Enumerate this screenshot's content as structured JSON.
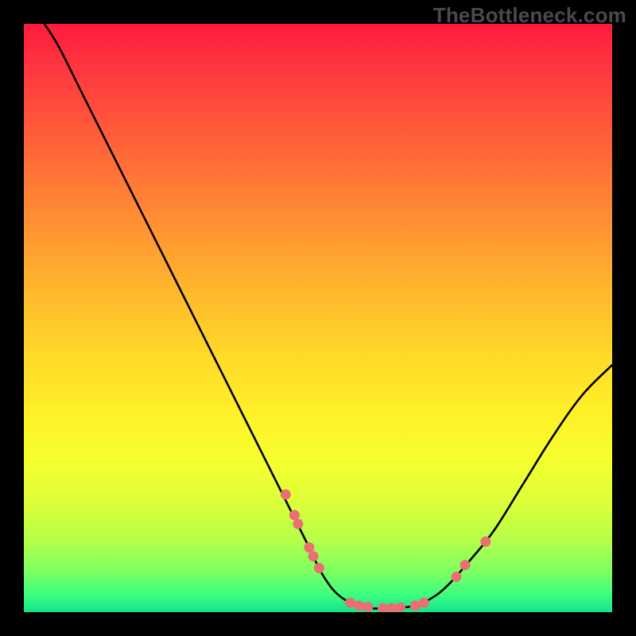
{
  "watermark": "TheBottleneck.com",
  "chart_data": {
    "type": "line",
    "title": "",
    "xlabel": "",
    "ylabel": "",
    "xlim": [
      0,
      100
    ],
    "ylim": [
      0,
      100
    ],
    "grid": false,
    "legend": false,
    "curve": [
      {
        "x": 3.5,
        "y": 100
      },
      {
        "x": 6,
        "y": 96
      },
      {
        "x": 10,
        "y": 88
      },
      {
        "x": 15,
        "y": 78
      },
      {
        "x": 20,
        "y": 68
      },
      {
        "x": 25,
        "y": 58
      },
      {
        "x": 30,
        "y": 48
      },
      {
        "x": 35,
        "y": 38
      },
      {
        "x": 40,
        "y": 28
      },
      {
        "x": 45,
        "y": 18
      },
      {
        "x": 48,
        "y": 12
      },
      {
        "x": 51,
        "y": 6
      },
      {
        "x": 54,
        "y": 2.5
      },
      {
        "x": 58,
        "y": 0.8
      },
      {
        "x": 62,
        "y": 0.7
      },
      {
        "x": 66,
        "y": 1.0
      },
      {
        "x": 69,
        "y": 2.2
      },
      {
        "x": 72,
        "y": 4.5
      },
      {
        "x": 76,
        "y": 9
      },
      {
        "x": 80,
        "y": 14
      },
      {
        "x": 85,
        "y": 22
      },
      {
        "x": 90,
        "y": 30
      },
      {
        "x": 95,
        "y": 37
      },
      {
        "x": 100,
        "y": 42
      }
    ],
    "points": [
      {
        "x": 44.5,
        "y": 20
      },
      {
        "x": 46.0,
        "y": 16.5
      },
      {
        "x": 46.6,
        "y": 15
      },
      {
        "x": 48.5,
        "y": 11
      },
      {
        "x": 49.2,
        "y": 9.5
      },
      {
        "x": 50.2,
        "y": 7.5
      },
      {
        "x": 55.5,
        "y": 1.6
      },
      {
        "x": 57.0,
        "y": 1.1
      },
      {
        "x": 58.5,
        "y": 0.9
      },
      {
        "x": 61.0,
        "y": 0.7
      },
      {
        "x": 62.5,
        "y": 0.7
      },
      {
        "x": 64.0,
        "y": 0.8
      },
      {
        "x": 66.5,
        "y": 1.1
      },
      {
        "x": 68.0,
        "y": 1.6
      },
      {
        "x": 73.5,
        "y": 6
      },
      {
        "x": 75.0,
        "y": 8
      },
      {
        "x": 78.5,
        "y": 12
      }
    ],
    "point_color": "#e96f72",
    "curve_color": "#000000"
  }
}
